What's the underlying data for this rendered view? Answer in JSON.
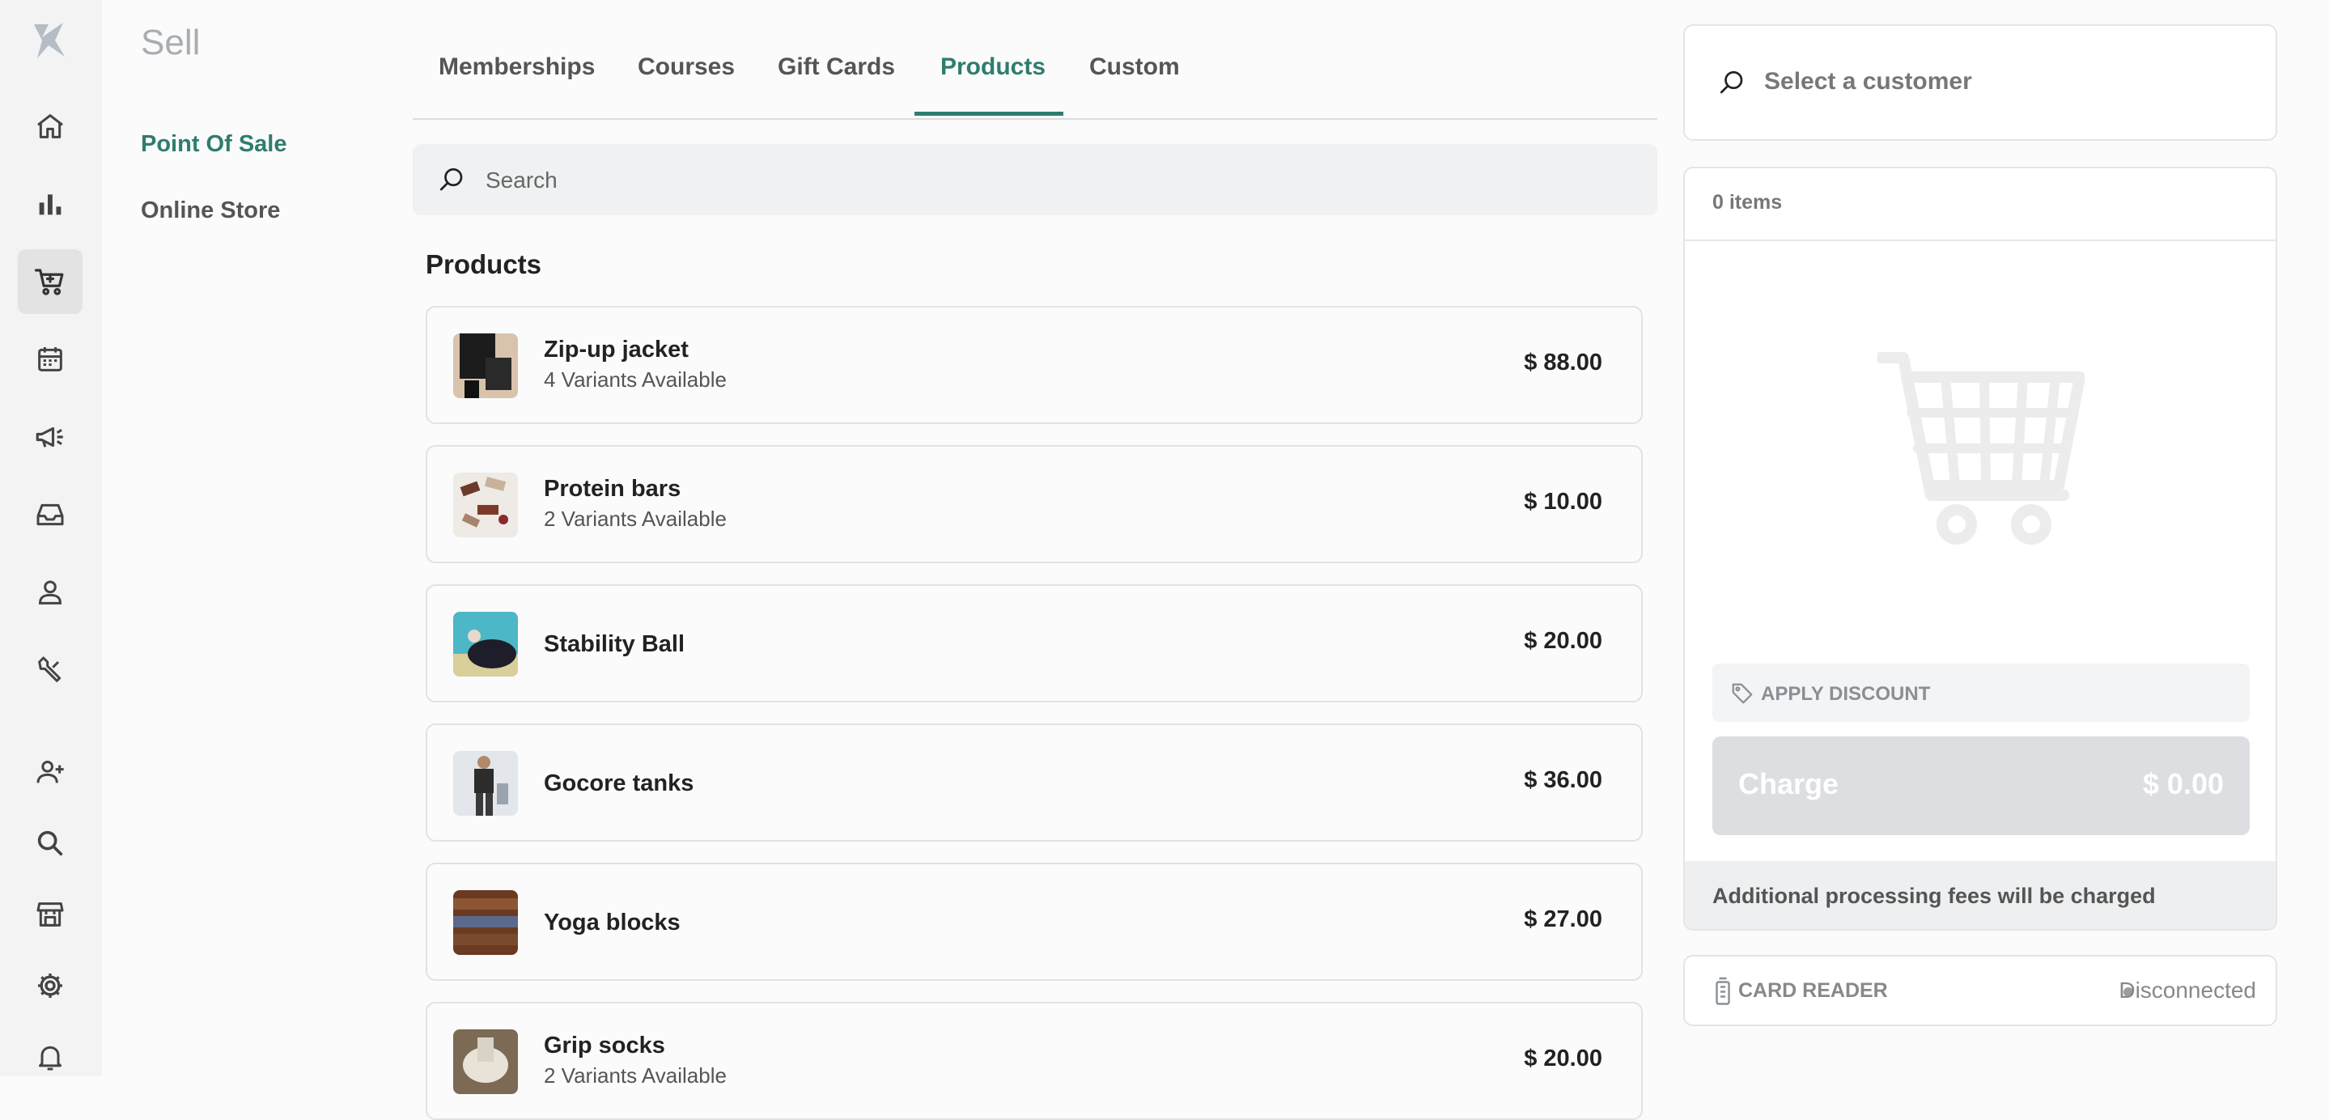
{
  "nav": {
    "items": [
      {
        "icon": "home-icon"
      },
      {
        "icon": "bar-chart-icon"
      },
      {
        "icon": "shopping-cart-icon",
        "active": true
      },
      {
        "icon": "calendar-icon"
      },
      {
        "icon": "megaphone-icon"
      },
      {
        "icon": "inbox-icon"
      },
      {
        "icon": "user-icon"
      },
      {
        "icon": "wrench-icon"
      },
      {
        "icon": "add-user-icon"
      },
      {
        "icon": "search-icon"
      },
      {
        "icon": "storefront-icon"
      },
      {
        "icon": "gear-icon"
      },
      {
        "icon": "bell-icon"
      }
    ]
  },
  "sidebar": {
    "title": "Sell",
    "links": [
      {
        "label": "Point Of Sale",
        "active": true
      },
      {
        "label": "Online Store",
        "active": false
      }
    ]
  },
  "tabs": [
    {
      "label": "Memberships"
    },
    {
      "label": "Courses"
    },
    {
      "label": "Gift Cards"
    },
    {
      "label": "Products",
      "active": true
    },
    {
      "label": "Custom"
    }
  ],
  "search": {
    "placeholder": "Search"
  },
  "products": {
    "heading": "Products",
    "items": [
      {
        "name": "Zip-up jacket",
        "variants": "4 Variants Available",
        "price": "$ 88.00"
      },
      {
        "name": "Protein bars",
        "variants": "2 Variants Available",
        "price": "$ 10.00"
      },
      {
        "name": "Stability Ball",
        "variants": "",
        "price": "$ 20.00"
      },
      {
        "name": "Gocore tanks",
        "variants": "",
        "price": "$ 36.00"
      },
      {
        "name": "Yoga blocks",
        "variants": "",
        "price": "$ 27.00"
      },
      {
        "name": "Grip socks",
        "variants": "2 Variants Available",
        "price": "$ 20.00"
      }
    ]
  },
  "customer": {
    "placeholder": "Select a customer"
  },
  "cart": {
    "count": "0 items",
    "discount_label": "APPLY DISCOUNT",
    "charge_label": "Charge",
    "charge_amount": "$ 0.00",
    "fees_note": "Additional processing fees will be charged"
  },
  "card_reader": {
    "label": "CARD READER",
    "status": "Disconnected"
  },
  "colors": {
    "accent": "#2e7d6e",
    "rail_bg": "#f3f3f3",
    "charge_bg": "#dcdee1"
  }
}
